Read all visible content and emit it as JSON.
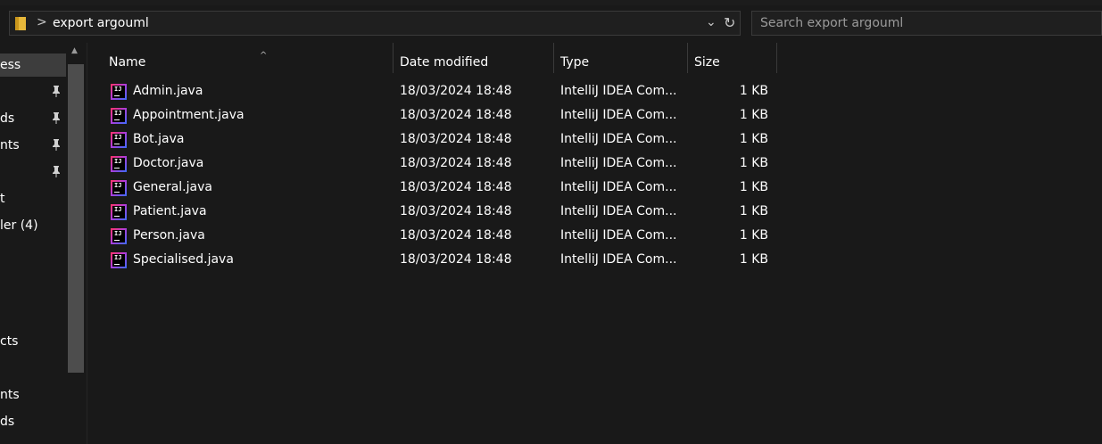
{
  "address": {
    "path": "export argouml",
    "separator": ">",
    "folder_icon": "folder-icon",
    "dropdown_icon": "chevron-down-icon",
    "refresh_icon": "refresh-icon"
  },
  "search": {
    "placeholder": "Search export argouml"
  },
  "nav": {
    "items": [
      {
        "label": "ess",
        "selected": true,
        "pinned": false
      },
      {
        "label": "",
        "pinned": true
      },
      {
        "label": "ds",
        "pinned": true
      },
      {
        "label": "nts",
        "pinned": true
      },
      {
        "label": "",
        "pinned": true
      },
      {
        "label": "t",
        "pinned": false
      },
      {
        "label": "ler (4)",
        "pinned": false
      },
      {
        "label": "cts",
        "pinned": false
      },
      {
        "label": "nts",
        "pinned": false
      },
      {
        "label": "ds",
        "pinned": false
      }
    ]
  },
  "columns": {
    "name": "Name",
    "date_modified": "Date modified",
    "type": "Type",
    "size": "Size",
    "sorted_by": "name"
  },
  "files": [
    {
      "name": "Admin.java",
      "date": "18/03/2024 18:48",
      "type": "IntelliJ IDEA Com...",
      "size": "1 KB"
    },
    {
      "name": "Appointment.java",
      "date": "18/03/2024 18:48",
      "type": "IntelliJ IDEA Com...",
      "size": "1 KB"
    },
    {
      "name": "Bot.java",
      "date": "18/03/2024 18:48",
      "type": "IntelliJ IDEA Com...",
      "size": "1 KB"
    },
    {
      "name": "Doctor.java",
      "date": "18/03/2024 18:48",
      "type": "IntelliJ IDEA Com...",
      "size": "1 KB"
    },
    {
      "name": "General.java",
      "date": "18/03/2024 18:48",
      "type": "IntelliJ IDEA Com...",
      "size": "1 KB"
    },
    {
      "name": "Patient.java",
      "date": "18/03/2024 18:48",
      "type": "IntelliJ IDEA Com...",
      "size": "1 KB"
    },
    {
      "name": "Person.java",
      "date": "18/03/2024 18:48",
      "type": "IntelliJ IDEA Com...",
      "size": "1 KB"
    },
    {
      "name": "Specialised.java",
      "date": "18/03/2024 18:48",
      "type": "IntelliJ IDEA Com...",
      "size": "1 KB"
    }
  ],
  "file_icon": "intellij-file-icon",
  "colors": {
    "background": "#191919",
    "selected": "#3d3d3d",
    "scrollbar": "#4d4d4d"
  }
}
